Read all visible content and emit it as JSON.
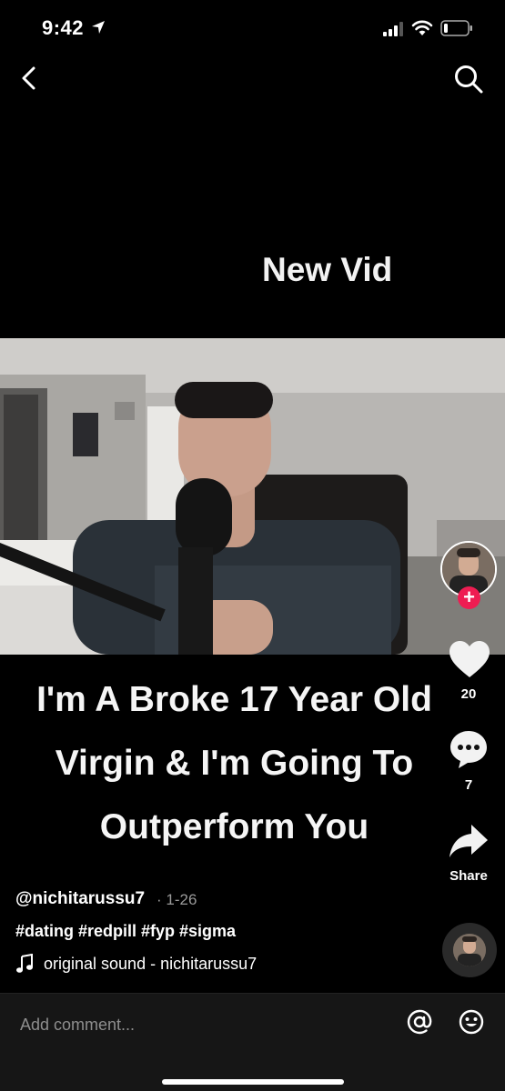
{
  "status_bar": {
    "time": "9:42",
    "icons": [
      "location-arrow-icon",
      "signal-icon",
      "wifi-icon",
      "battery-icon"
    ]
  },
  "nav": {
    "back_icon": "chevron-left-icon",
    "search_icon": "search-icon"
  },
  "video": {
    "top_caption": "New Vid",
    "caption_lines": [
      "I'm A Broke 17 Year Old",
      "Virgin & I'm Going To",
      "Outperform You"
    ]
  },
  "rail": {
    "follow_label": "+",
    "like_count": "20",
    "comment_count": "7",
    "share_label": "Share"
  },
  "post": {
    "username": "@nichitarussu7",
    "date": "· 1-26",
    "hashtags": "#dating #redpill #fyp #sigma",
    "sound": "original sound - nichitarussu7"
  },
  "comment_bar": {
    "placeholder": "Add comment...",
    "icons": [
      "at-mention-icon",
      "emoji-icon"
    ]
  },
  "colors": {
    "background": "#000000",
    "follow_accent": "#ee1d52",
    "comment_bar_bg": "#161616"
  }
}
